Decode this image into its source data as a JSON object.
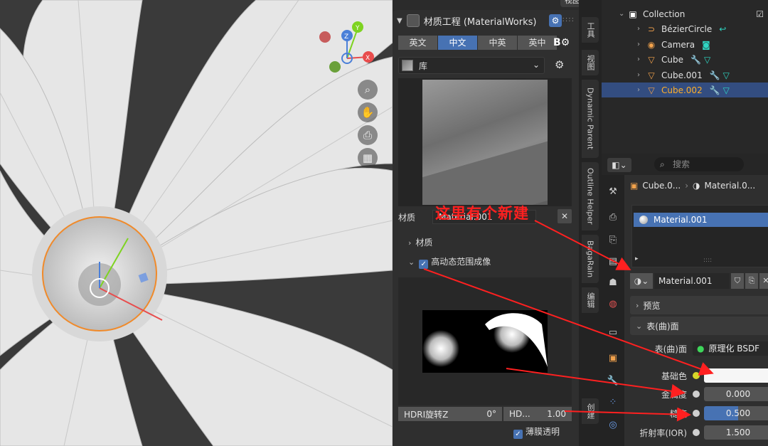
{
  "viewport": {
    "view_tab": "视图",
    "nav_icons": [
      "zoom-icon",
      "hand-pan-icon",
      "camera-icon",
      "grid-icon"
    ]
  },
  "materialworks": {
    "title": "材质工程 (MaterialWorks)",
    "drag_handle": "::::",
    "lang_tabs": [
      "英文",
      "中文",
      "中英",
      "英中"
    ],
    "active_lang": "中文",
    "b_logo": "B⚙",
    "library_label": "库",
    "material_label": "材质",
    "material_name": "Material.001",
    "section_material": "材质",
    "section_hdri": "高动态范围成像",
    "hdri_rotate_label": "HDRI旋转Z",
    "hdri_rotate_value": "0°",
    "hdri_strength_label": "HD...",
    "hdri_strength_value": "1.00",
    "film_transparent": "薄膜透明"
  },
  "vertical_tabs": [
    "工具",
    "视图",
    "Dynamic Parent",
    "Outline Helper",
    "BagaRain",
    "编辑",
    "创建"
  ],
  "outliner": {
    "collection": "Collection",
    "items": [
      {
        "name": "BézierCircle",
        "selected": false
      },
      {
        "name": "Camera",
        "selected": false
      },
      {
        "name": "Cube",
        "selected": false
      },
      {
        "name": "Cube.001",
        "selected": false
      },
      {
        "name": "Cube.002",
        "selected": true
      }
    ]
  },
  "properties": {
    "search_placeholder": "搜索",
    "breadcrumb_object": "Cube.0...",
    "breadcrumb_material": "Material.0...",
    "slot_material": "Material.001",
    "selector_material": "Material.001",
    "panel_preview": "预览",
    "panel_surface": "表(曲)面",
    "rows": [
      {
        "label": "表(曲)面",
        "value": "原理化 BSDF"
      },
      {
        "label": "基础色",
        "value": ""
      },
      {
        "label": "金属度",
        "value": "0.000"
      },
      {
        "label": "糙度",
        "value": "0.500"
      },
      {
        "label": "折射率(IOR)",
        "value": "1.500"
      }
    ],
    "roughness_fraction": 0.5
  },
  "annotation": {
    "text": "这里有个新建",
    "color": "#ff2020"
  },
  "colors": {
    "accent_blue": "#4772b3",
    "selected_row": "#334d80",
    "selected_text": "#ffaf29",
    "panel_bg": "#2f2f2f"
  }
}
